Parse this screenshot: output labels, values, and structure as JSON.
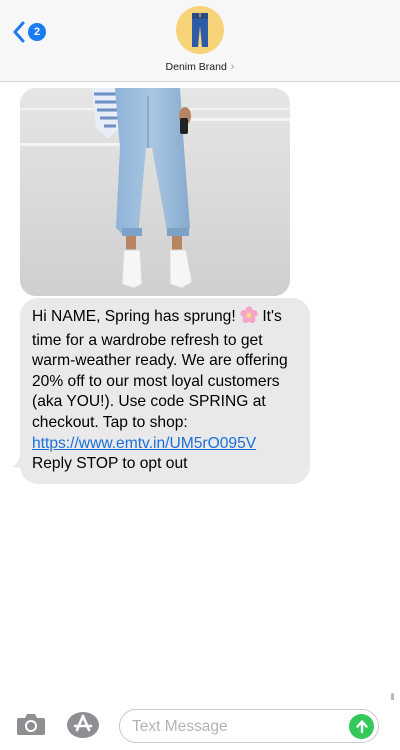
{
  "header": {
    "back_badge": "2",
    "contact_name": "Denim Brand",
    "chevron": "›",
    "avatar_icon": "jeans-icon"
  },
  "message": {
    "image_desc_icon": "photo",
    "text_before_emoji": "Hi NAME, Spring has sprung! ",
    "emoji": "cherry-blossom-icon",
    "text_after_emoji": " It's time for a wardrobe refresh to get warm-weather ready. We are offering 20% off to our most loyal customers (aka YOU!). Use code SPRING at checkout. Tap to shop:",
    "link": "https://www.emtv.in/UM5rO095V",
    "text_after_link": " Reply STOP to opt out"
  },
  "composer": {
    "placeholder": "Text Message",
    "camera_icon": "camera-icon",
    "apps_icon": "app-store-icon",
    "send_icon": "send-arrow-icon"
  },
  "colors": {
    "accent_blue": "#1a7cf5",
    "bubble_gray": "#e9e9eb",
    "send_green": "#34c759",
    "avatar_yellow": "#f7d37a"
  }
}
